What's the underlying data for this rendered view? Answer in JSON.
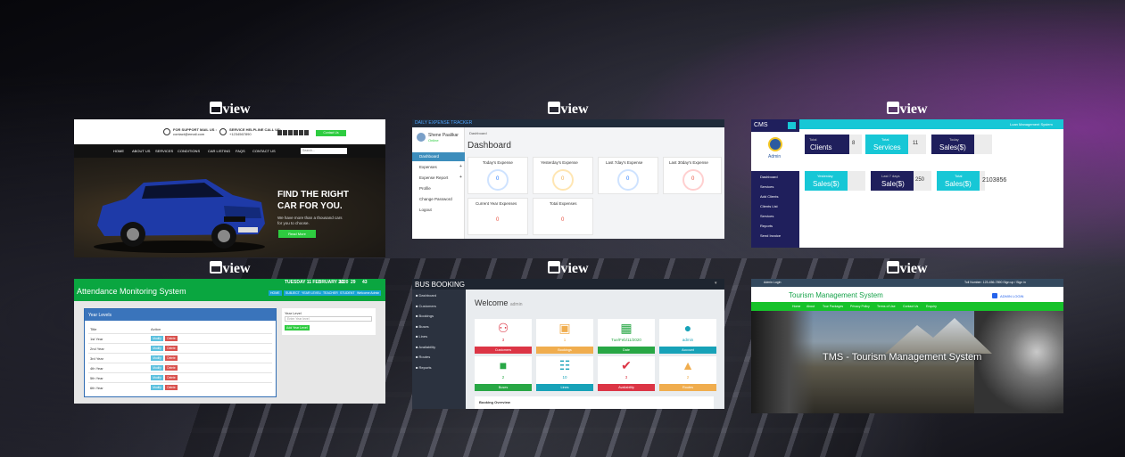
{
  "view_label": "view",
  "c1": {
    "support_label": "FOR SUPPORT MAIL US :",
    "support_email": "contact@email.com",
    "helpline_label": "SERVICE HELPLINE CALL US:",
    "helpline_phone": "+1234567890",
    "cta": "Contact Us",
    "nav": [
      "HOME",
      "ABOUT US",
      "SERVICES",
      "CONDITIONS",
      "CAR LISTING",
      "FAQS",
      "CONTACT US"
    ],
    "search_placeholder": "Search...",
    "hero_title1": "FIND THE RIGHT",
    "hero_title2": "CAR FOR YOU.",
    "hero_sub1": "We have more than a thousand cars",
    "hero_sub2": "for you to choose.",
    "read_more": "Read More"
  },
  "c2": {
    "app_title": "DAILY EXPENSE TRACKER",
    "user": "Shene Paalikar",
    "user_status": "Online",
    "breadcrumb": "Dashboard",
    "sidebar": [
      "Dashboard",
      "Expenses",
      "Expense Report",
      "Profile",
      "Change Password",
      "Logout"
    ],
    "heading": "Dashboard",
    "stats": [
      {
        "label": "Today's Expense",
        "value": "0"
      },
      {
        "label": "Yesterday's Expense",
        "value": "0"
      },
      {
        "label": "Last 7day's Expense",
        "value": "0"
      },
      {
        "label": "Last 30day's Expense",
        "value": "0"
      },
      {
        "label": "Current Year Expenses",
        "value": "0"
      },
      {
        "label": "Total Expenses",
        "value": "0"
      }
    ]
  },
  "c3": {
    "brand": "CMS",
    "topright": "Loan Management System",
    "admin": "Admin",
    "sidebar": [
      "Dashboard",
      "Services",
      "Add Clients",
      "Clients List",
      "Services",
      "Reports",
      "Send Invoice"
    ],
    "row1": [
      {
        "small": "Total",
        "big": "Clients",
        "value": "8"
      },
      {
        "small": "Total",
        "big": "Services",
        "value": "11"
      },
      {
        "small": "Today",
        "big": "Sales($)",
        "value": ""
      }
    ],
    "row2": [
      {
        "small": "Yesterday",
        "big": "Sales($)",
        "value": ""
      },
      {
        "small": "Last 7 days",
        "big": "Sale($)",
        "value": "250"
      },
      {
        "small": "Total",
        "big": "Sales($)",
        "value": "2103856"
      }
    ]
  },
  "c4": {
    "title": "Attendance Monitoring System",
    "date_text": "TUESDAY 11 FEBRUARY 2020",
    "time": [
      "12",
      "29",
      "43"
    ],
    "nav": [
      "HOME",
      "SUBJECT",
      "YEAR LEVELS",
      "TEACHER",
      "STUDENT",
      "Welcome Admin"
    ],
    "panel_title": "Year Levels",
    "col_title": "Title",
    "col_action": "Action",
    "rows": [
      "1st Year",
      "2nd Year",
      "3rd Year",
      "4th Year",
      "5th Year",
      "6th Year"
    ],
    "modify": "Modify",
    "delete": "Delete",
    "form_label": "Year Level",
    "form_placeholder": "Enter Year level",
    "form_button": "Add Year Level"
  },
  "c5": {
    "title": "BUS BOOKING",
    "sidebar": [
      "Dashboard",
      "Customers",
      "Bookings",
      "Buses",
      "Lines",
      "Availability",
      "Routes",
      "Reports"
    ],
    "welcome": "Welcome",
    "welcome_user": "admin",
    "tiles": [
      {
        "value": "3",
        "label": "Customers",
        "color": "#dc3545",
        "icon": "users"
      },
      {
        "value": "1",
        "label": "Bookings",
        "color": "#f0ad4e",
        "icon": "money"
      },
      {
        "value": "Tue/Feb/11/2020",
        "label": "Date",
        "color": "#28a745",
        "icon": "calendar"
      },
      {
        "value": "admin",
        "label": "Account",
        "color": "#17a2b8",
        "icon": "user"
      },
      {
        "value": "2",
        "label": "Buses",
        "color": "#28a745",
        "icon": "truck"
      },
      {
        "value": "10",
        "label": "Lines",
        "color": "#17a2b8",
        "icon": "sitemap"
      },
      {
        "value": "3",
        "label": "Availability",
        "color": "#dc3545",
        "icon": "check"
      },
      {
        "value": "2",
        "label": "Routes",
        "color": "#f0ad4e",
        "icon": "road"
      }
    ],
    "footer": "Booking Overview"
  },
  "c6": {
    "top_left": "Admin Login",
    "top_right": "Toll Number: 123-456-7890   Sign up  /  Sign in",
    "title": "Tourism Management System",
    "util": "ADMIN LOGIN",
    "nav": [
      "Home",
      "About",
      "Tour Packages",
      "Privacy Policy",
      "Terms of Use",
      "Contact Us",
      "Enquiry"
    ],
    "hero": "TMS - Tourism Management System"
  }
}
